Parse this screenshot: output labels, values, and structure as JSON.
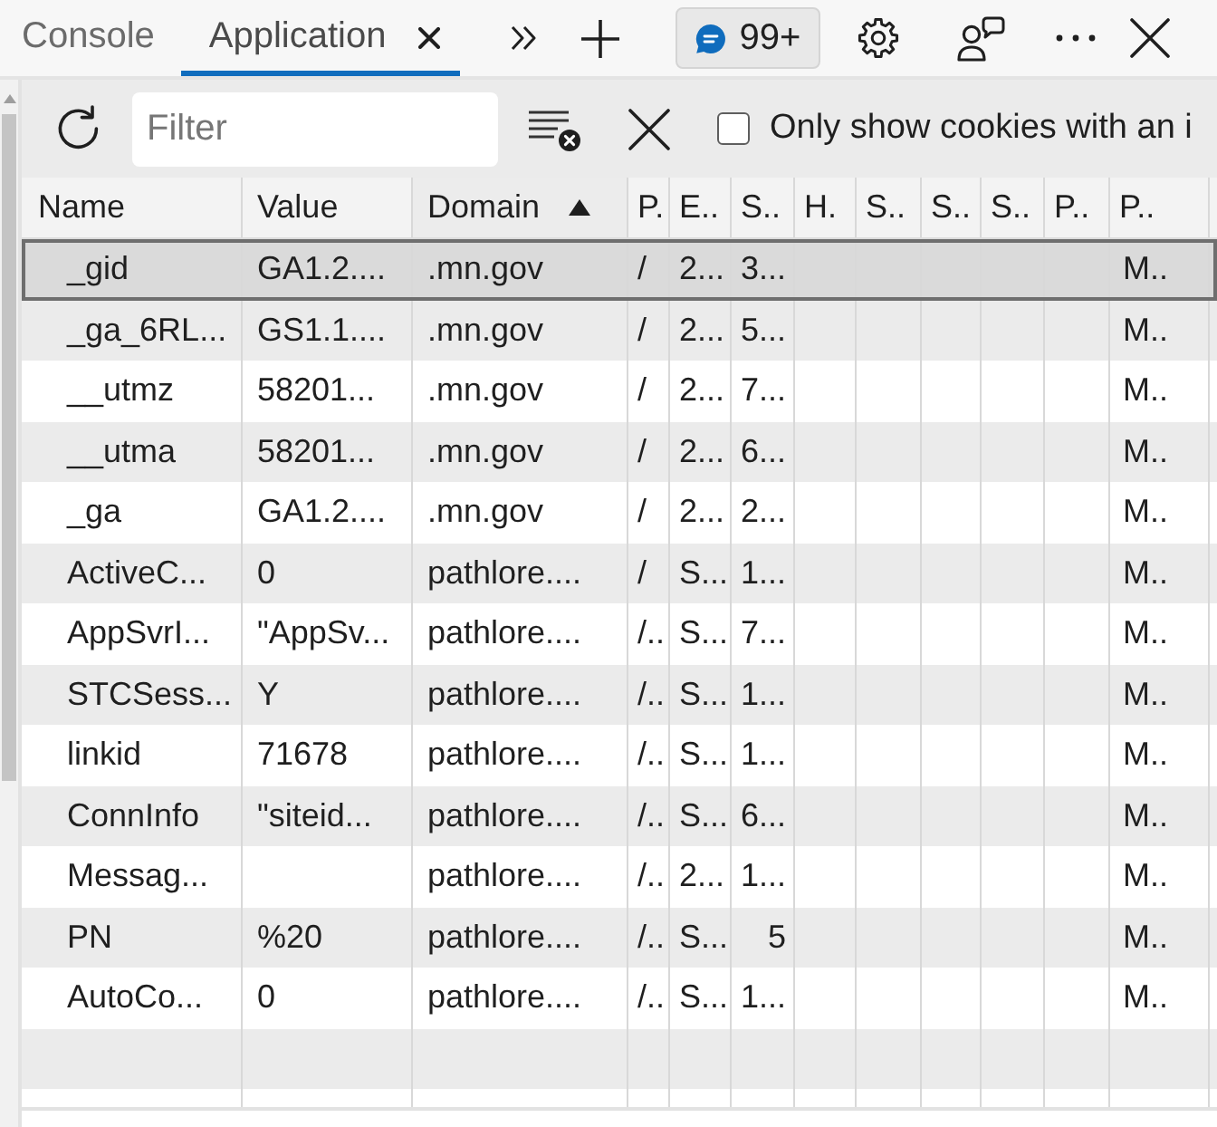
{
  "tabs": [
    {
      "label": "Console",
      "selected": false
    },
    {
      "label": "Application",
      "selected": true
    }
  ],
  "issues_badge": {
    "count": "99+"
  },
  "toolbar": {
    "filter": {
      "placeholder": "Filter"
    },
    "cookie_filter": {
      "label": "Only show cookies with an i",
      "checked": false
    }
  },
  "table": {
    "columns": [
      {
        "label": "Name",
        "sorted": false
      },
      {
        "label": "Value",
        "sorted": false
      },
      {
        "label": "Domain",
        "sorted": true
      },
      {
        "label": "P.",
        "sorted": false
      },
      {
        "label": "E..",
        "sorted": false
      },
      {
        "label": "S..",
        "sorted": false
      },
      {
        "label": "H.",
        "sorted": false
      },
      {
        "label": "S..",
        "sorted": false
      },
      {
        "label": "S..",
        "sorted": false
      },
      {
        "label": "S..",
        "sorted": false
      },
      {
        "label": "P..",
        "sorted": false
      },
      {
        "label": "P..",
        "sorted": false
      }
    ],
    "rows": [
      {
        "selected": true,
        "name": "_gid",
        "value": "GA1.2....",
        "domain": ".mn.gov",
        "column_4": "/",
        "column_5": "2...",
        "column_6": "3...",
        "column_12": "M.."
      },
      {
        "selected": false,
        "name": "_ga_6RL...",
        "value": "GS1.1....",
        "domain": ".mn.gov",
        "column_4": "/",
        "column_5": "2...",
        "column_6": "5...",
        "column_12": "M.."
      },
      {
        "selected": false,
        "name": "__utmz",
        "value": "58201...",
        "domain": ".mn.gov",
        "column_4": "/",
        "column_5": "2...",
        "column_6": "7...",
        "column_12": "M.."
      },
      {
        "selected": false,
        "name": "__utma",
        "value": "58201...",
        "domain": ".mn.gov",
        "column_4": "/",
        "column_5": "2...",
        "column_6": "6...",
        "column_12": "M.."
      },
      {
        "selected": false,
        "name": "_ga",
        "value": "GA1.2....",
        "domain": ".mn.gov",
        "column_4": "/",
        "column_5": "2...",
        "column_6": "2...",
        "column_12": "M.."
      },
      {
        "selected": false,
        "name": "ActiveC...",
        "value": "0",
        "domain": "pathlore....",
        "column_4": "/",
        "column_5": "S...",
        "column_6": "1...",
        "column_12": "M.."
      },
      {
        "selected": false,
        "name": "AppSvrI...",
        "value": "\"AppSv...",
        "domain": "pathlore....",
        "column_4": "/..",
        "column_5": "S...",
        "column_6": "7...",
        "column_12": "M.."
      },
      {
        "selected": false,
        "name": "STCSess...",
        "value": "Y",
        "domain": "pathlore....",
        "column_4": "/..",
        "column_5": "S...",
        "column_6": "1...",
        "column_12": "M.."
      },
      {
        "selected": false,
        "name": "linkid",
        "value": "71678",
        "domain": "pathlore....",
        "column_4": "/..",
        "column_5": "S...",
        "column_6": "1...",
        "column_12": "M.."
      },
      {
        "selected": false,
        "name": "ConnInfo",
        "value": "\"siteid...",
        "domain": "pathlore....",
        "column_4": "/..",
        "column_5": "S...",
        "column_6": "6...",
        "column_12": "M.."
      },
      {
        "selected": false,
        "name": "Messag...",
        "domain": "pathlore....",
        "column_4": "/..",
        "column_5": "2...",
        "column_6": "1...",
        "column_12": "M.."
      },
      {
        "selected": false,
        "name": "PN",
        "value": "%20",
        "domain": "pathlore....",
        "column_4": "/..",
        "column_5": "S...",
        "column_6": "5",
        "column_12": "M.."
      },
      {
        "selected": false,
        "name": "AutoCo...",
        "value": "0",
        "domain": "pathlore....",
        "column_4": "/..",
        "column_5": "S...",
        "column_6": "1...",
        "column_12": "M.."
      }
    ]
  }
}
